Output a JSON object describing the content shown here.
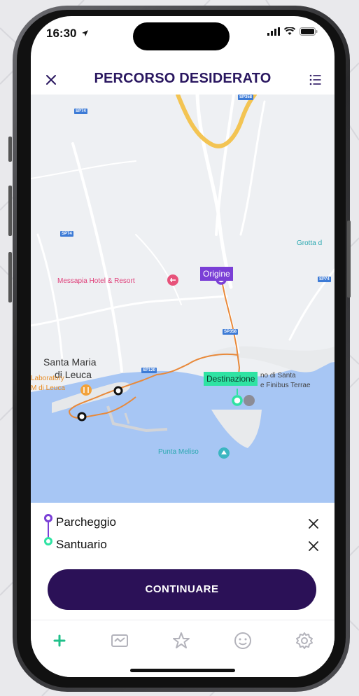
{
  "status_bar": {
    "time": "16:30"
  },
  "header": {
    "title": "PERCORSO DESIDERATO"
  },
  "map": {
    "places": {
      "hotel": "Messapia Hotel & Resort",
      "town_line1": "Santa Maria",
      "town_line2": "di Leuca",
      "laboratory_line1": "Laboratory",
      "laboratory_line2": "M di Leuca",
      "grotta": "Grotta d",
      "santuario_line1": "no di Santa",
      "santuario_line2": "e Finibus Terrae",
      "punta": "Punta Meliso"
    },
    "road_signs": [
      "SP74",
      "SP74",
      "SP74",
      "SP358",
      "SP358",
      "SP120",
      "SP358"
    ],
    "tags": {
      "origin": "Origine",
      "destination": "Destinazione"
    }
  },
  "route": {
    "stops": [
      {
        "label": "Parcheggio"
      },
      {
        "label": "Santuario"
      }
    ]
  },
  "actions": {
    "continue_label": "CONTINUARE"
  },
  "tabs": [
    "add",
    "tickets",
    "favorites",
    "profile",
    "settings"
  ],
  "colors": {
    "primary": "#2b1157",
    "origin": "#7a3fd6",
    "destination": "#2fe3a3",
    "accent": "#20c08a"
  }
}
